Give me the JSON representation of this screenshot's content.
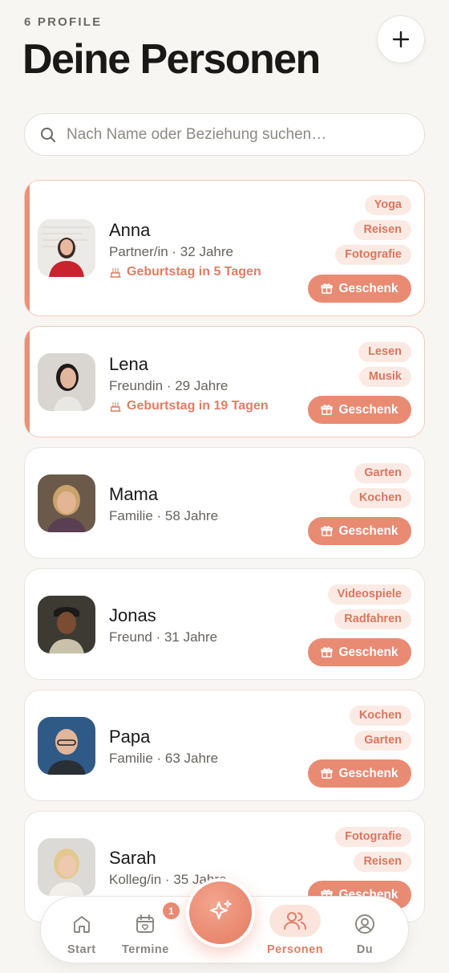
{
  "header": {
    "count_label": "6 PROFILE",
    "title": "Deine Personen"
  },
  "search": {
    "placeholder": "Nach Name oder Beziehung suchen…",
    "value": ""
  },
  "gift_label": "Geschenk",
  "colors": {
    "accent": "#e98a73",
    "accent_text": "#e07d65",
    "tag_bg": "#fbeae4",
    "background": "#f8f6f3"
  },
  "people": [
    {
      "name": "Anna",
      "subtitle": "Partner/in · 32 Jahre",
      "birthday": "Geburtstag in 5 Tagen",
      "tags": [
        "Yoga",
        "Reisen",
        "Fotografie"
      ],
      "highlighted": true
    },
    {
      "name": "Lena",
      "subtitle": "Freundin · 29 Jahre",
      "birthday": "Geburtstag in 19 Tagen",
      "tags": [
        "Lesen",
        "Musik"
      ],
      "highlighted": true
    },
    {
      "name": "Mama",
      "subtitle": "Familie · 58 Jahre",
      "tags": [
        "Garten",
        "Kochen"
      ],
      "highlighted": false
    },
    {
      "name": "Jonas",
      "subtitle": "Freund · 31 Jahre",
      "tags": [
        "Videospiele",
        "Radfahren"
      ],
      "highlighted": false
    },
    {
      "name": "Papa",
      "subtitle": "Familie · 63 Jahre",
      "tags": [
        "Kochen",
        "Garten"
      ],
      "highlighted": false
    },
    {
      "name": "Sarah",
      "subtitle": "Kolleg/in · 35 Jahre",
      "tags": [
        "Fotografie",
        "Reisen"
      ],
      "highlighted": false
    }
  ],
  "nav": {
    "start": "Start",
    "termine": "Termine",
    "termine_badge": "1",
    "personen": "Personen",
    "du": "Du",
    "active": "Personen"
  }
}
